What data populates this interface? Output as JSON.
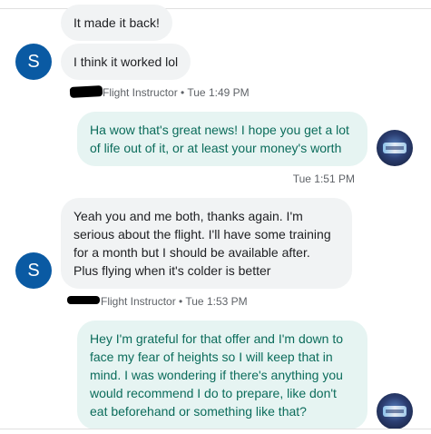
{
  "conversation": {
    "messages": [
      {
        "direction": "incoming",
        "text": "It made it back!"
      },
      {
        "direction": "incoming",
        "text": "I think it worked lol",
        "avatar_letter": "S"
      },
      {
        "direction": "incoming_meta",
        "sender": "Flight Instructor",
        "separator": "•",
        "time": "Tue 1:49 PM"
      },
      {
        "direction": "outgoing",
        "text": "Ha wow that's great news! I hope you get a lot\nof life out of it, or at least your money's worth"
      },
      {
        "direction": "outgoing_meta",
        "time": "Tue 1:51 PM"
      },
      {
        "direction": "incoming",
        "text": "Yeah you and me both, thanks again. I'm\nserious about the flight. I'll have some training\nfor a month but I should be available after.\nPlus flying when it's colder is better",
        "avatar_letter": "S"
      },
      {
        "direction": "incoming_meta",
        "sender": "Flight Instructor",
        "separator": "•",
        "time": "Tue 1:53 PM"
      },
      {
        "direction": "outgoing",
        "text": "Hey I'm grateful for that offer and I'm down to\nface my fear of heights so I will keep that in\nmind. I was wondering if there's anything you\nwould recommend I do to prepare, like don't\neat beforehand or something like that?"
      }
    ]
  },
  "colors": {
    "incoming_bubble": "#f1f3f4",
    "outgoing_bubble": "#e6f4f2",
    "outgoing_text": "#0b6c5b",
    "avatar_bg": "#0a5aa3",
    "meta_text": "#5f6368"
  }
}
